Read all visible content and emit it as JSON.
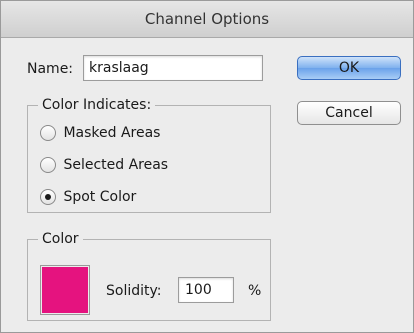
{
  "window": {
    "title": "Channel Options"
  },
  "name_field": {
    "label": "Name:",
    "value": "kraslaag"
  },
  "buttons": {
    "ok": "OK",
    "cancel": "Cancel"
  },
  "color_indicates": {
    "legend": "Color Indicates:",
    "options": [
      {
        "label": "Masked Areas",
        "selected": false
      },
      {
        "label": "Selected Areas",
        "selected": false
      },
      {
        "label": "Spot Color",
        "selected": true
      }
    ]
  },
  "color_group": {
    "legend": "Color",
    "swatch_color": "#e5137f",
    "solidity_label": "Solidity:",
    "solidity_value": "100",
    "unit": "%"
  },
  "colors": {
    "default_button": "#6aa2ea"
  }
}
